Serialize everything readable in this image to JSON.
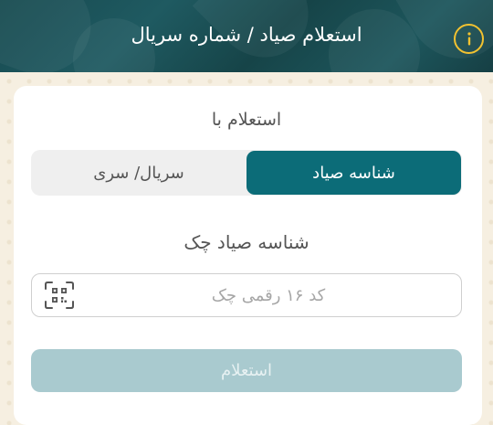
{
  "header": {
    "title": "استعلام صیاد / شماره سریال",
    "info_icon": "info-icon",
    "background_color": "#1a4f55",
    "info_color": "#f2c230"
  },
  "form": {
    "inquiry_with_label": "استعلام با",
    "segments": [
      {
        "label": "شناسه صیاد",
        "selected": true
      },
      {
        "label": "سریال/ سری",
        "selected": false
      }
    ],
    "field_label": "شناسه صیاد چک",
    "code_input": {
      "value": "",
      "placeholder": "کد ۱۶ رقمی چک"
    },
    "qr_icon": "qr-scan-icon",
    "submit_label": "استعلام",
    "accent_color": "#0c6c78",
    "disabled_button_color": "#a9cacf"
  }
}
